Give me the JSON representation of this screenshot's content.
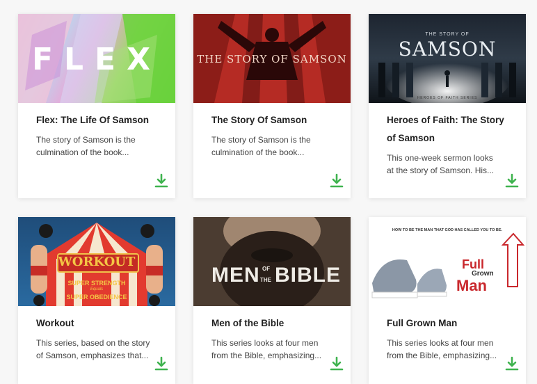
{
  "cards": [
    {
      "image_text": {
        "main": "FLEX"
      },
      "title": "Flex: The Life Of Samson",
      "desc_line1": "The story of Samson is the",
      "desc_line2": "culmination of the book..."
    },
    {
      "image_text": {
        "main": "THE STORY OF SAMSON"
      },
      "title": "The Story Of Samson",
      "desc_line1": "The story of Samson is the",
      "desc_line2": "culmination of the book..."
    },
    {
      "image_text": {
        "top": "THE STORY OF",
        "main": "SAMSON",
        "bottom": "HEROES OF FAITH SERIES"
      },
      "title_line1": "Heroes of Faith: The Story",
      "title_line2": "of Samson",
      "desc_line1": "This one-week sermon looks",
      "desc_line2": "at the story of Samson. His..."
    },
    {
      "image_text": {
        "main": "WORKOUT",
        "line1": "SUPER STRENGTH",
        "line2": "Equals",
        "line3": "SUPER OBEDIENCE"
      },
      "title": "Workout",
      "desc_line1": "This series, based on the story",
      "desc_line2": "of Samson, emphasizes that..."
    },
    {
      "image_text": {
        "men": "MEN",
        "of": "OF",
        "the": "THE",
        "bible": "BIBLE"
      },
      "title": "Men of the Bible",
      "desc_line1": "This series looks at four men",
      "desc_line2": "from the Bible, emphasizing..."
    },
    {
      "image_text": {
        "top": "HOW TO BE THE MAN THAT GOD HAS CALLED YOU TO BE.",
        "full": "Full",
        "grown": "Grown",
        "man": "Man"
      },
      "title": "Full Grown Man",
      "desc_line1": "This series looks at four men",
      "desc_line2": "from the Bible, emphasizing..."
    }
  ],
  "colors": {
    "download": "#3fb34f",
    "title": "#222222",
    "desc": "#444444"
  },
  "icons": {
    "download": "download-icon"
  }
}
